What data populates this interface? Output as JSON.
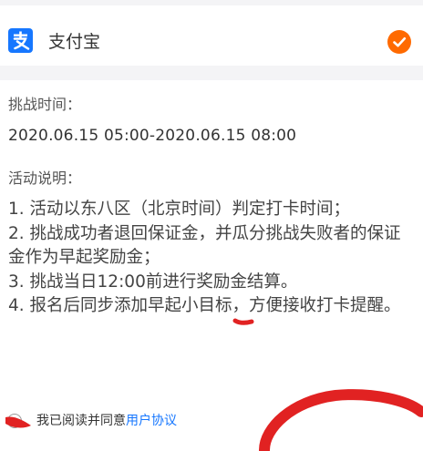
{
  "payment": {
    "method_name": "支付宝",
    "icon": "alipay-logo",
    "selected_icon": "check-circle-icon"
  },
  "challenge": {
    "time_label": "挑战时间：",
    "time_value": "2020.06.15 05:00-2020.06.15 08:00"
  },
  "rules": {
    "label": "活动说明：",
    "text": "1. 活动以东八区（北京时间）判定打卡时间；\n2. 挑战成功者退回保证金，并瓜分挑战失败者的保证金作为早起奖励金；\n3. 挑战当日12:00前进行奖励金结算。\n4. 报名后同步添加早起小目标，方便接收打卡提醒。"
  },
  "agreement": {
    "prefix": "我已阅读并同意",
    "link": "用户协议"
  },
  "colors": {
    "brand_blue": "#1677ff",
    "accent_orange": "#ff6a00",
    "annotation_red": "#e12222"
  }
}
